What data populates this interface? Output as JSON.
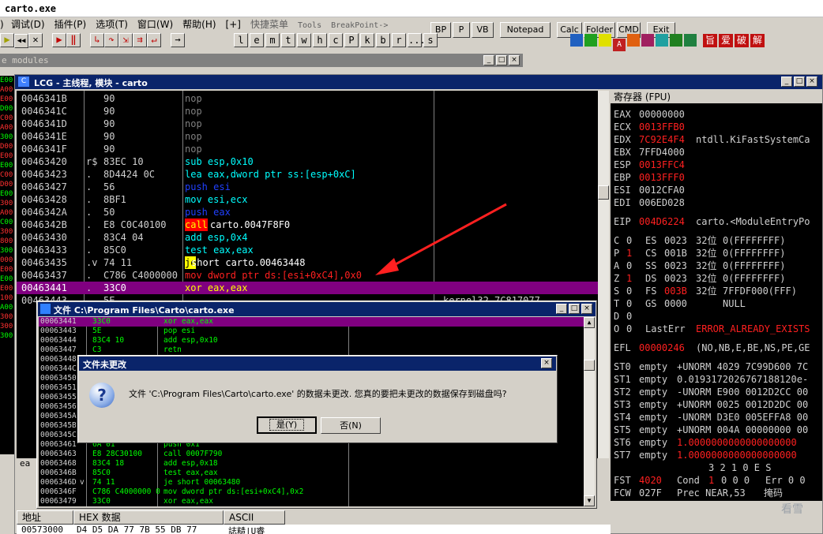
{
  "app": {
    "title": "carto.exe"
  },
  "menu": [
    {
      "label": "调试(D)"
    },
    {
      "label": "插件(P)"
    },
    {
      "label": "选项(T)"
    },
    {
      "label": "窗口(W)"
    },
    {
      "label": "帮助(H)"
    },
    {
      "label": "[+]"
    },
    {
      "label": "快捷菜单"
    },
    {
      "label": "Tools"
    },
    {
      "label": "BreakPoint->"
    }
  ],
  "quick_buttons": [
    {
      "label": "BP"
    },
    {
      "label": "P"
    },
    {
      "label": "VB"
    },
    {
      "label": "Notepad"
    },
    {
      "label": "Calc"
    },
    {
      "label": "Folder"
    },
    {
      "label": "CMD"
    },
    {
      "label": "Exit"
    }
  ],
  "letter_buttons": [
    "l",
    "e",
    "m",
    "t",
    "w",
    "h",
    "c",
    "P",
    "k",
    "b",
    "r",
    "...",
    "s"
  ],
  "cjk_icons": [
    "旨",
    "爱",
    "破",
    "解"
  ],
  "modules_title": "e modules",
  "cpu": {
    "title": "LCG - 主线程, 模块 - carto",
    "rows": [
      {
        "addr": "0046341B",
        "mark": "",
        "hex": "90",
        "asm": "nop"
      },
      {
        "addr": "0046341C",
        "mark": "",
        "hex": "90",
        "asm": "nop"
      },
      {
        "addr": "0046341D",
        "mark": "",
        "hex": "90",
        "asm": "nop"
      },
      {
        "addr": "0046341E",
        "mark": "",
        "hex": "90",
        "asm": "nop"
      },
      {
        "addr": "0046341F",
        "mark": "",
        "hex": "90",
        "asm": "nop"
      },
      {
        "addr": "00463420",
        "mark": "r$",
        "hex": "83EC 10",
        "asm": "sub esp,0x10"
      },
      {
        "addr": "00463423",
        "mark": ".",
        "hex": "8D4424 0C",
        "asm": "lea eax,dword ptr ss:[esp+0xC]"
      },
      {
        "addr": "00463427",
        "mark": ".",
        "hex": "56",
        "asm": "push esi"
      },
      {
        "addr": "00463428",
        "mark": ".",
        "hex": "8BF1",
        "asm": "mov esi,ecx"
      },
      {
        "addr": "0046342A",
        "mark": ".",
        "hex": "50",
        "asm": "push eax"
      },
      {
        "addr": "0046342B",
        "mark": ".",
        "hex": "E8 C0C40100",
        "asm_kw": "call",
        "asm_rest": " carto.0047F8F0"
      },
      {
        "addr": "00463430",
        "mark": ".",
        "hex": "83C4 04",
        "asm": "add esp,0x4"
      },
      {
        "addr": "00463433",
        "mark": ".",
        "hex": "85C0",
        "asm": "test eax,eax"
      },
      {
        "addr": "00463435",
        "mark": ".v",
        "hex": "74 11",
        "asm_kw": "je",
        "asm_rest": " short carto.00463448"
      },
      {
        "addr": "00463437",
        "mark": ".",
        "hex": "C786 C4000000",
        "asm": "mov dword ptr ds:[esi+0xC4],0x0"
      },
      {
        "addr": "00463441",
        "mark": ".",
        "hex": "33C0",
        "asm": "xor eax,eax"
      },
      {
        "addr": "00463443",
        "mark": ".",
        "hex": "5E",
        "asm": ""
      }
    ],
    "comment_partial": "kernel32.7C817077"
  },
  "registers": {
    "title": "寄存器 (FPU)",
    "gpr": [
      {
        "name": "EAX",
        "val": "00000000",
        "info": ""
      },
      {
        "name": "ECX",
        "val": "0013FFB0",
        "info": ""
      },
      {
        "name": "EDX",
        "val": "7C92E4F4",
        "info": "ntdll.KiFastSystemCa"
      },
      {
        "name": "EBX",
        "val": "7FFD4000",
        "info": ""
      },
      {
        "name": "ESP",
        "val": "0013FFC4",
        "info": ""
      },
      {
        "name": "EBP",
        "val": "0013FFF0",
        "info": ""
      },
      {
        "name": "ESI",
        "val": "0012CFA0",
        "info": ""
      },
      {
        "name": "EDI",
        "val": "006ED028",
        "info": ""
      }
    ],
    "eip": {
      "name": "EIP",
      "val": "004D6224",
      "info": "carto.<ModuleEntryPo"
    },
    "flags": [
      {
        "f": "C",
        "v": "0",
        "seg": "ES",
        "sv": "0023",
        "bits": "32位",
        "base": "0(FFFFFFFF)"
      },
      {
        "f": "P",
        "v": "1",
        "seg": "CS",
        "sv": "001B",
        "bits": "32位",
        "base": "0(FFFFFFFF)"
      },
      {
        "f": "A",
        "v": "0",
        "seg": "SS",
        "sv": "0023",
        "bits": "32位",
        "base": "0(FFFFFFFF)"
      },
      {
        "f": "Z",
        "v": "1",
        "seg": "DS",
        "sv": "0023",
        "bits": "32位",
        "base": "0(FFFFFFFF)"
      },
      {
        "f": "S",
        "v": "0",
        "seg": "FS",
        "sv": "003B",
        "bits": "32位",
        "base": "7FFDF000(FFF)"
      },
      {
        "f": "T",
        "v": "0",
        "seg": "GS",
        "sv": "0000",
        "bits": "",
        "base": "NULL"
      },
      {
        "f": "D",
        "v": "0",
        "seg": "",
        "sv": "",
        "bits": "",
        "base": ""
      },
      {
        "f": "O",
        "v": "0",
        "seg": "LastErr",
        "sv": "",
        "bits": "",
        "base": "ERROR_ALREADY_EXISTS"
      }
    ],
    "efl": {
      "name": "EFL",
      "val": "00000246",
      "info": "(NO,NB,E,BE,NS,PE,GE"
    },
    "st": [
      {
        "name": "ST0",
        "tag": "empty",
        "val": "+UNORM 4029 7C99D600 7C"
      },
      {
        "name": "ST1",
        "tag": "empty",
        "val": "0.0193172026767188120e-"
      },
      {
        "name": "ST2",
        "tag": "empty",
        "val": "-UNORM E900 0012D2CC 00"
      },
      {
        "name": "ST3",
        "tag": "empty",
        "val": "+UNORM 0025 0012D2DC 00"
      },
      {
        "name": "ST4",
        "tag": "empty",
        "val": "-UNORM D3E0 005EFFA8 00"
      },
      {
        "name": "ST5",
        "tag": "empty",
        "val": "+UNORM 004A 00000000 00"
      },
      {
        "name": "ST6",
        "tag": "empty",
        "val": "1.0000000000000000000"
      },
      {
        "name": "ST7",
        "tag": "empty",
        "val": "1.0000000000000000000"
      }
    ],
    "fpu_hdr": "3 2 1 0      E S",
    "fst": {
      "name": "FST",
      "val": "4020",
      "cond": "Cond",
      "cv": "1",
      "bits": "0 0 0",
      "err": "Err 0 0"
    },
    "fcw": {
      "name": "FCW",
      "val": "027F",
      "prec": "Prec NEAR,53",
      "mask": "掩码"
    }
  },
  "file_window": {
    "title": "文件 C:\\Program Files\\Carto\\carto.exe",
    "rows": [
      {
        "addr": "00063441",
        "hex": "33C0",
        "asm": "xor eax,eax"
      },
      {
        "addr": "00063443",
        "hex": "5E",
        "asm": "pop esi"
      },
      {
        "addr": "00063444",
        "hex": "83C4 10",
        "asm": "add esp,0x10"
      },
      {
        "addr": "00063447",
        "hex": "C3",
        "asm": "retn"
      },
      {
        "addr": "00063448",
        "hex": "",
        "asm": ""
      },
      {
        "addr": "0006344C",
        "hex": "",
        "asm": ""
      },
      {
        "addr": "00063450",
        "hex": "",
        "asm": ""
      },
      {
        "addr": "00063451",
        "hex": "",
        "asm": ""
      },
      {
        "addr": "00063455",
        "hex": "",
        "asm": ""
      },
      {
        "addr": "00063456",
        "hex": "",
        "asm": ""
      },
      {
        "addr": "0006345A",
        "hex": "",
        "asm": ""
      },
      {
        "addr": "0006345B",
        "hex": "",
        "asm": ""
      },
      {
        "addr": "0006345C",
        "hex": "",
        "asm": ""
      },
      {
        "addr": "00063461",
        "hex": "6A 01",
        "asm": "push 0x1"
      },
      {
        "addr": "00063463",
        "hex": "E8 28C30100",
        "asm": "call 0007F790"
      },
      {
        "addr": "00063468",
        "hex": "83C4 18",
        "asm": "add esp,0x18"
      },
      {
        "addr": "0006346B",
        "hex": "85C0",
        "asm": "test eax,eax"
      },
      {
        "addr": "0006346D",
        "hex": "74 11",
        "asm": "je short 00063480"
      },
      {
        "addr": "0006346F",
        "hex": "C786 C4000000 0",
        "asm": "mov dword ptr ds:[esi+0xC4],0x2"
      },
      {
        "addr": "00063479",
        "hex": "33C0",
        "asm": "xor eax,eax"
      }
    ]
  },
  "dialog": {
    "title": "文件未更改",
    "message": "文件 'C:\\Program Files\\Carto\\carto.exe' 的数据未更改. 您真的要把未更改的数据保存到磁盘吗?",
    "yes_label": "是(Y)",
    "no_label": "否(N)"
  },
  "dump": {
    "col_addr": "地址",
    "col_hex": "HEX 数据",
    "col_ascii": "ASCII",
    "row_addr": "00573000",
    "row_hex": "D4 D5 DA 77 7B 55 DB 77",
    "row_ascii": "誌糙|U睿"
  },
  "left_strip": [
    "E00",
    "A00",
    "E00",
    "D00",
    "C00",
    "A00",
    "300",
    "D00",
    "E00",
    "E00",
    "C00",
    "D00",
    "E00",
    "300",
    "A00",
    "C00",
    "300",
    "800",
    "300",
    "000",
    "E00",
    "E00",
    "E00",
    "100",
    "A00",
    "300",
    "300",
    "300"
  ],
  "bottom_left_label": "ea",
  "watermark": "看雪",
  "colors": {
    "accent_red": "#ff2020",
    "cursor_purple": "#800080",
    "asm_cyan": "#00ffff",
    "call_bg": "#ff0000",
    "title_blue": "#0a246a"
  }
}
